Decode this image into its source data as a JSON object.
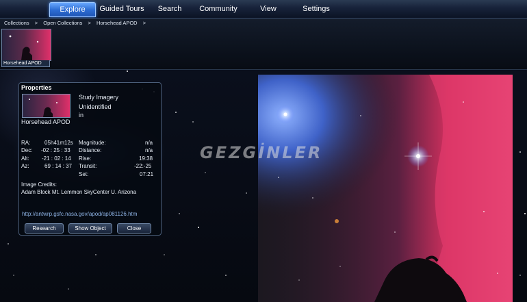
{
  "menu": {
    "tabs": [
      {
        "label": "Explore",
        "active": true
      },
      {
        "label": "Guided Tours"
      },
      {
        "label": "Search"
      },
      {
        "label": "Community"
      },
      {
        "label": "View"
      },
      {
        "label": "Settings"
      }
    ]
  },
  "breadcrumb": {
    "items": [
      "Collections",
      ">",
      "Open Collections",
      ">",
      "Horsehead APOD",
      ">"
    ]
  },
  "collection": {
    "thumb_label": "Horsehead APOD"
  },
  "watermark": "GEZGİNLER",
  "properties": {
    "title": "Properties",
    "type": "Study Imagery",
    "classification": "Unidentified",
    "constellation_prefix": "in",
    "name": "Horsehead APOD",
    "rows": [
      {
        "l": "RA:",
        "lv": "05h41m12s",
        "r": "Magnitude:",
        "rv": "n/a"
      },
      {
        "l": "Dec:",
        "lv": "-02 : 25 : 33",
        "r": "Distance:",
        "rv": "n/a"
      },
      {
        "l": "Alt:",
        "lv": "-21 : 02 : 14",
        "r": "Rise:",
        "rv": "19:38"
      },
      {
        "l": "Az:",
        "lv": "69 : 14 : 37",
        "r": "Transit:",
        "rv": "-22:-25"
      },
      {
        "l": "",
        "lv": "",
        "r": "Set:",
        "rv": "07:21"
      }
    ],
    "credits_label": "Image Credits:",
    "credits": "Adam Block Mt. Lemmon SkyCenter U. Arizona",
    "url": "http://antwrp.gsfc.nasa.gov/apod/ap081126.htm",
    "buttons": {
      "research": "Research",
      "show_object": "Show Object",
      "close": "Close"
    }
  }
}
